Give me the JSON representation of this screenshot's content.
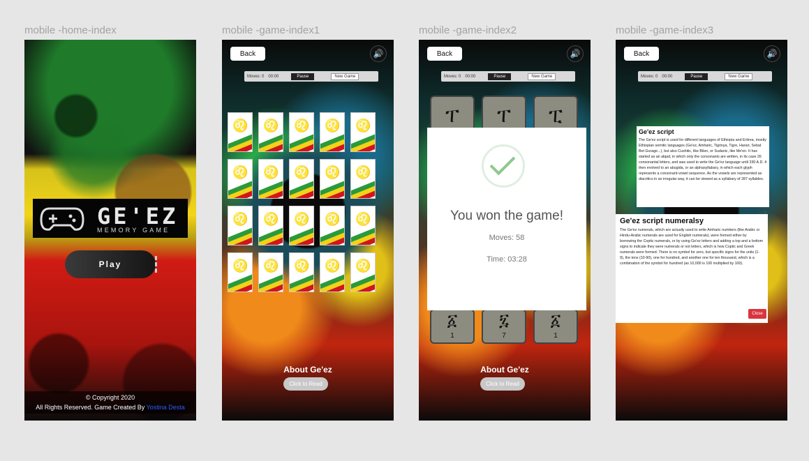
{
  "frames": {
    "home": {
      "label": "mobile -home-index",
      "logo_title": "GE'EZ",
      "logo_subtitle": "MEMORY GAME",
      "play_label": "Play",
      "copyright_line1": "© Copyright 2020",
      "copyright_line2": "All Rights Reserved. Game Created By ",
      "author": "Yostina Desta"
    },
    "game1": {
      "label": "mobile -game-index1"
    },
    "game2": {
      "label": "mobile -game-index2"
    },
    "game3": {
      "label": "mobile -game-index3"
    }
  },
  "common": {
    "back_label": "Back",
    "moves_label": "Moves: 0",
    "time_label": "00:00",
    "pause_label": "Pause",
    "new_game_label": "New Game",
    "about_label": "About Ge'ez",
    "read_label": "Click to Read"
  },
  "win": {
    "title": "You won the game!",
    "moves": "Moves: 58",
    "time": "Time: 03:28",
    "tiles_top": [
      "ፐ",
      "ፐ",
      "ፒ"
    ],
    "tiles_bottom": [
      {
        "glyph": "፩",
        "n": "1"
      },
      {
        "glyph": "፯",
        "n": "7"
      },
      {
        "glyph": "፩",
        "n": "1"
      }
    ]
  },
  "info": {
    "script_title": "Ge'ez script",
    "script_text": "The Ge'ez script is used for different languages of Ethiopia and Eritrea, mostly Ethiopian semitic languages (Ge'ez, Amharic, Tigrinya, Tigre, Harari, Sebat Bet Gurage...), but also Cushitic, like Bilen, or Sudanic, like Me'en. It has started as an abjad, in which only the consonants are written, in its case 26 consonantal letters, and was used to write the Ge'ez language until 330 A.D. It then evolved to an abugida, or an alphasyllabary, in which each glyph represents a consonant-vowel sequence. As the vowels are represented as diacritics in an irregular way, it can be viewed as a syllabary of 287 syllables.",
    "close_x": "×",
    "numerals_title": "Ge'ez script numeralsy",
    "numerals_text": "The Ge'ez numerals, which are actually used to write Amharic numbers (like Arabic or Hindu-Arabic numerals are used for English numerals), were formed either by borrowing the Coptic numerals, or by using Ge'ez letters and adding a top and a bottom signs to indicate they were numerals or not letters, which is how Coptic and Greek numerals were formed. There is no symbol for zero, but specific signs for the units (1-9), the tens (10-90), one for hundred, and another one for ten thousand, which is a combination of the symbol for hundred (as 10,000 is 100 multiplied by 100).",
    "close_label": "Close"
  }
}
